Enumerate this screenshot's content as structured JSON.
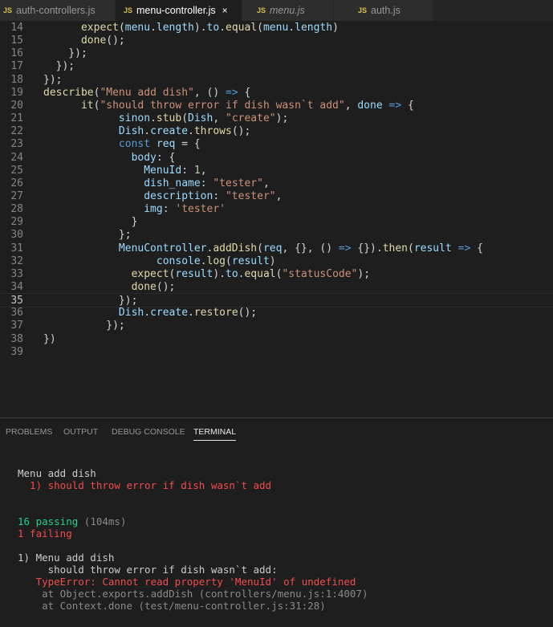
{
  "tabs": [
    {
      "icon": "JS",
      "label": "auth-controllers.js",
      "italic": false,
      "active": false
    },
    {
      "icon": "JS",
      "label": "menu-controller.js",
      "italic": false,
      "active": true,
      "close": "×"
    },
    {
      "icon": "JS",
      "label": "menu.js",
      "italic": true,
      "active": false
    },
    {
      "icon": "JS",
      "label": "auth.js",
      "italic": false,
      "active": false
    }
  ],
  "editor": {
    "current_line": 35,
    "lines": [
      {
        "n": "14",
        "tokens": [
          [
            "pl",
            "      "
          ],
          [
            "fn",
            "expect"
          ],
          [
            "pl",
            "("
          ],
          [
            "var",
            "menu"
          ],
          [
            "pl",
            "."
          ],
          [
            "var",
            "length"
          ],
          [
            "pl",
            ")."
          ],
          [
            "var",
            "to"
          ],
          [
            "pl",
            "."
          ],
          [
            "fn",
            "equal"
          ],
          [
            "pl",
            "("
          ],
          [
            "var",
            "menu"
          ],
          [
            "pl",
            "."
          ],
          [
            "var",
            "length"
          ],
          [
            "pl",
            ")"
          ]
        ]
      },
      {
        "n": "15",
        "tokens": [
          [
            "pl",
            "      "
          ],
          [
            "fn",
            "done"
          ],
          [
            "pl",
            "();"
          ]
        ]
      },
      {
        "n": "16",
        "tokens": [
          [
            "pl",
            "    });"
          ]
        ]
      },
      {
        "n": "17",
        "tokens": [
          [
            "pl",
            "  });"
          ]
        ]
      },
      {
        "n": "18",
        "tokens": [
          [
            "pl",
            "});"
          ]
        ]
      },
      {
        "n": "19",
        "tokens": [
          [
            "fn",
            "describe"
          ],
          [
            "pl",
            "("
          ],
          [
            "str",
            "\"Menu add dish\""
          ],
          [
            "pl",
            ", () "
          ],
          [
            "kw",
            "=>"
          ],
          [
            "pl",
            " {"
          ]
        ]
      },
      {
        "n": "20",
        "tokens": [
          [
            "pl",
            "      "
          ],
          [
            "fn",
            "it"
          ],
          [
            "pl",
            "("
          ],
          [
            "str",
            "\"should throw error if dish wasn`t add\""
          ],
          [
            "pl",
            ", "
          ],
          [
            "var",
            "done"
          ],
          [
            "pl",
            " "
          ],
          [
            "kw",
            "=>"
          ],
          [
            "pl",
            " {"
          ]
        ]
      },
      {
        "n": "21",
        "tokens": [
          [
            "pl",
            "            "
          ],
          [
            "var",
            "sinon"
          ],
          [
            "pl",
            "."
          ],
          [
            "fn",
            "stub"
          ],
          [
            "pl",
            "("
          ],
          [
            "var",
            "Dish"
          ],
          [
            "pl",
            ", "
          ],
          [
            "str",
            "\"create\""
          ],
          [
            "pl",
            ");"
          ]
        ]
      },
      {
        "n": "22",
        "tokens": [
          [
            "pl",
            "            "
          ],
          [
            "var",
            "Dish"
          ],
          [
            "pl",
            "."
          ],
          [
            "var",
            "create"
          ],
          [
            "pl",
            "."
          ],
          [
            "fn",
            "throws"
          ],
          [
            "pl",
            "();"
          ]
        ]
      },
      {
        "n": "23",
        "tokens": [
          [
            "pl",
            "            "
          ],
          [
            "kw",
            "const"
          ],
          [
            "pl",
            " "
          ],
          [
            "var",
            "req"
          ],
          [
            "pl",
            " = {"
          ]
        ]
      },
      {
        "n": "24",
        "tokens": [
          [
            "pl",
            "              "
          ],
          [
            "var",
            "body"
          ],
          [
            "pl",
            ": {"
          ]
        ]
      },
      {
        "n": "25",
        "tokens": [
          [
            "pl",
            "                "
          ],
          [
            "var",
            "MenuId"
          ],
          [
            "pl",
            ": "
          ],
          [
            "num",
            "1"
          ],
          [
            "pl",
            ","
          ]
        ]
      },
      {
        "n": "26",
        "tokens": [
          [
            "pl",
            "                "
          ],
          [
            "var",
            "dish_name"
          ],
          [
            "pl",
            ": "
          ],
          [
            "str",
            "\"tester\""
          ],
          [
            "pl",
            ","
          ]
        ]
      },
      {
        "n": "27",
        "tokens": [
          [
            "pl",
            "                "
          ],
          [
            "var",
            "description"
          ],
          [
            "pl",
            ": "
          ],
          [
            "str",
            "\"tester\""
          ],
          [
            "pl",
            ","
          ]
        ]
      },
      {
        "n": "28",
        "tokens": [
          [
            "pl",
            "                "
          ],
          [
            "var",
            "img"
          ],
          [
            "pl",
            ": "
          ],
          [
            "str",
            "'tester'"
          ]
        ]
      },
      {
        "n": "29",
        "tokens": [
          [
            "pl",
            "              }"
          ]
        ]
      },
      {
        "n": "30",
        "tokens": [
          [
            "pl",
            "            };"
          ]
        ]
      },
      {
        "n": "31",
        "tokens": [
          [
            "pl",
            "            "
          ],
          [
            "var",
            "MenuController"
          ],
          [
            "pl",
            "."
          ],
          [
            "fn",
            "addDish"
          ],
          [
            "pl",
            "("
          ],
          [
            "var",
            "req"
          ],
          [
            "pl",
            ", {}, () "
          ],
          [
            "kw",
            "=>"
          ],
          [
            "pl",
            " {})."
          ],
          [
            "fn",
            "then"
          ],
          [
            "pl",
            "("
          ],
          [
            "var",
            "result"
          ],
          [
            "pl",
            " "
          ],
          [
            "kw",
            "=>"
          ],
          [
            "pl",
            " {"
          ]
        ]
      },
      {
        "n": "32",
        "tokens": [
          [
            "pl",
            "                  "
          ],
          [
            "var",
            "console"
          ],
          [
            "pl",
            "."
          ],
          [
            "fn",
            "log"
          ],
          [
            "pl",
            "("
          ],
          [
            "var",
            "result"
          ],
          [
            "pl",
            ")"
          ]
        ]
      },
      {
        "n": "33",
        "tokens": [
          [
            "pl",
            "              "
          ],
          [
            "fn",
            "expect"
          ],
          [
            "pl",
            "("
          ],
          [
            "var",
            "result"
          ],
          [
            "pl",
            ")."
          ],
          [
            "var",
            "to"
          ],
          [
            "pl",
            "."
          ],
          [
            "fn",
            "equal"
          ],
          [
            "pl",
            "("
          ],
          [
            "str",
            "\"statusCode\""
          ],
          [
            "pl",
            ");"
          ]
        ]
      },
      {
        "n": "34",
        "tokens": [
          [
            "pl",
            "              "
          ],
          [
            "fn",
            "done"
          ],
          [
            "pl",
            "();"
          ]
        ]
      },
      {
        "n": "35",
        "tokens": [
          [
            "pl",
            "            });"
          ]
        ]
      },
      {
        "n": "36",
        "tokens": [
          [
            "pl",
            "            "
          ],
          [
            "var",
            "Dish"
          ],
          [
            "pl",
            "."
          ],
          [
            "var",
            "create"
          ],
          [
            "pl",
            "."
          ],
          [
            "fn",
            "restore"
          ],
          [
            "pl",
            "();"
          ]
        ]
      },
      {
        "n": "37",
        "tokens": [
          [
            "pl",
            "          });"
          ]
        ]
      },
      {
        "n": "38",
        "tokens": [
          [
            "pl",
            "})"
          ]
        ]
      },
      {
        "n": "39",
        "tokens": []
      }
    ]
  },
  "panel": {
    "tabs": [
      "PROBLEMS",
      "OUTPUT",
      "DEBUG CONSOLE",
      "TERMINAL"
    ],
    "active_tab": "TERMINAL",
    "terminal": {
      "suite_title": "Menu add dish",
      "failed_test": "  1) should throw error if dish wasn`t add",
      "passing_count": "16 passing",
      "passing_time": " (104ms)",
      "failing_count": "1 failing",
      "failure_header": "1) Menu add dish",
      "failure_test": "     should throw error if dish wasn`t add:",
      "error_message": "   TypeError: Cannot read property 'MenuId' of undefined",
      "stack_1": "    at Object.exports.addDish (controllers/menu.js:1:4007)",
      "stack_2": "    at Context.done (test/menu-controller.js:31:28)"
    }
  }
}
